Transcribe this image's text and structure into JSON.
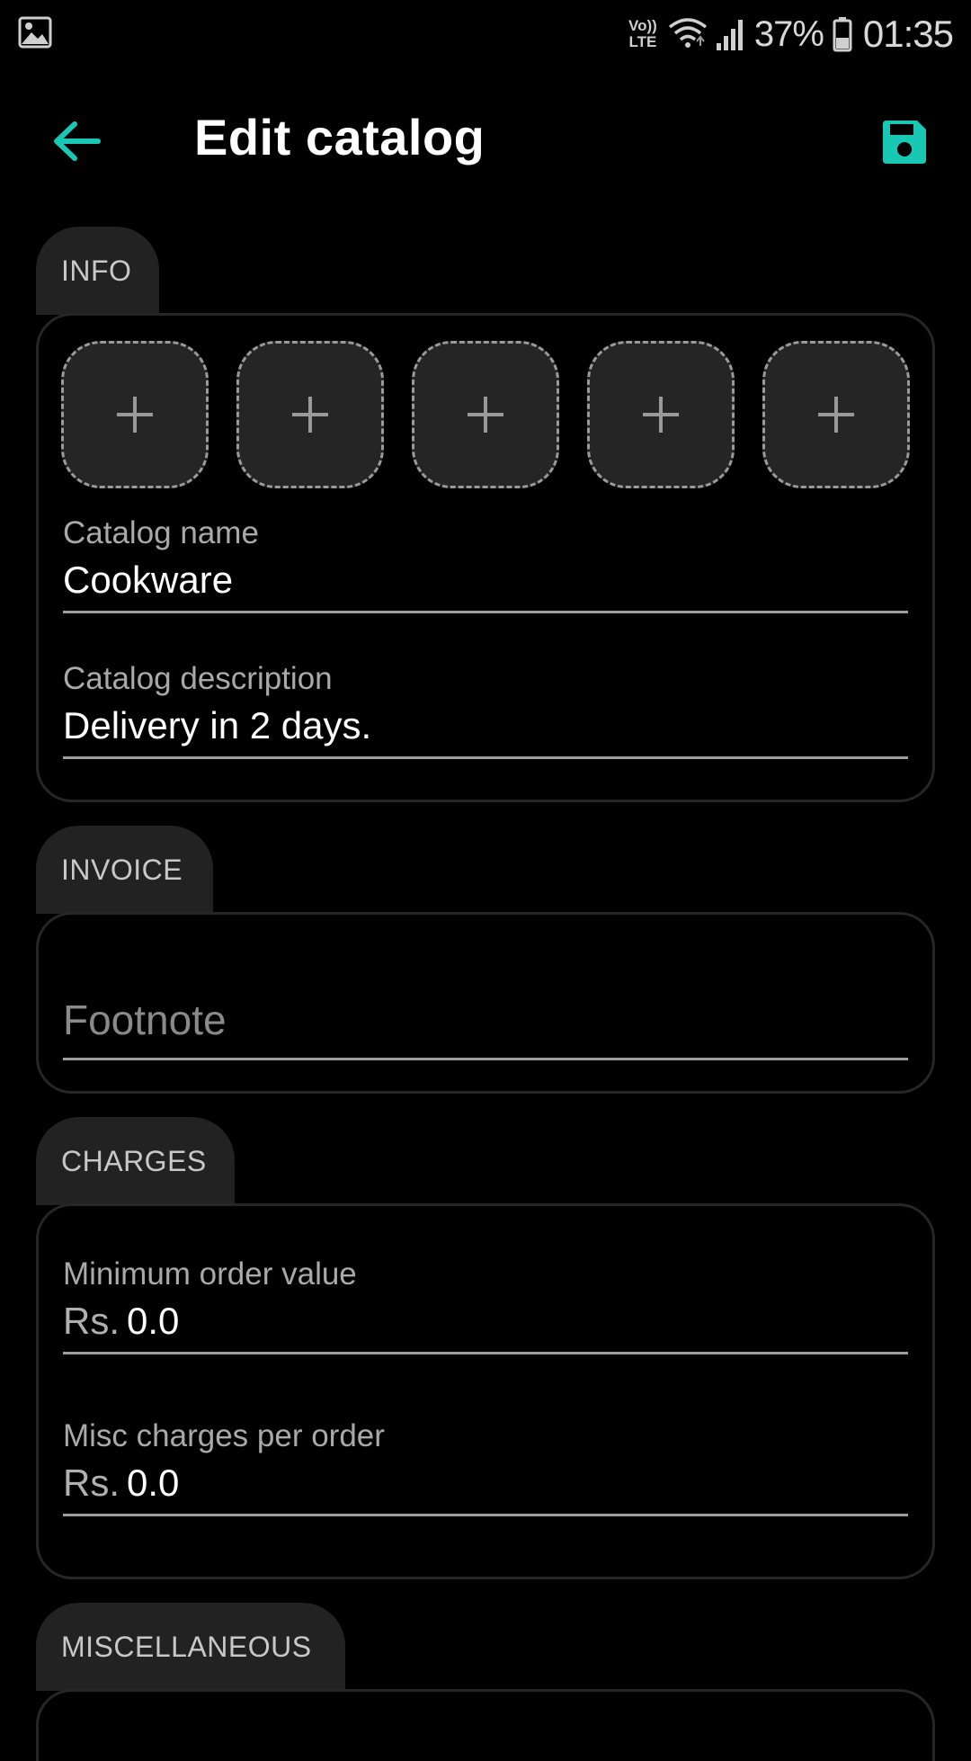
{
  "status_bar": {
    "network_label_top": "Vo))",
    "network_label_bottom": "LTE",
    "battery_percent": "37%",
    "time": "01:35"
  },
  "app_bar": {
    "title": "Edit catalog",
    "back_icon": "arrow-back-icon",
    "save_icon": "save-icon"
  },
  "colors": {
    "accent": "#19c7b5",
    "background": "#000000",
    "tab_background": "#222222"
  },
  "info": {
    "tab_label": "INFO",
    "image_slots": [
      "+",
      "+",
      "+",
      "+",
      "+"
    ],
    "catalog_name_label": "Catalog name",
    "catalog_name_value": "Cookware",
    "catalog_description_label": "Catalog description",
    "catalog_description_value": "Delivery in 2 days."
  },
  "invoice": {
    "tab_label": "INVOICE",
    "footnote_placeholder": "Footnote"
  },
  "charges": {
    "tab_label": "CHARGES",
    "min_order_label": "Minimum order value",
    "min_order_prefix": "Rs.",
    "min_order_value": "0.0",
    "misc_charges_label": "Misc charges per order",
    "misc_charges_prefix": "Rs.",
    "misc_charges_value": "0.0"
  },
  "miscellaneous": {
    "tab_label": "MISCELLANEOUS"
  }
}
